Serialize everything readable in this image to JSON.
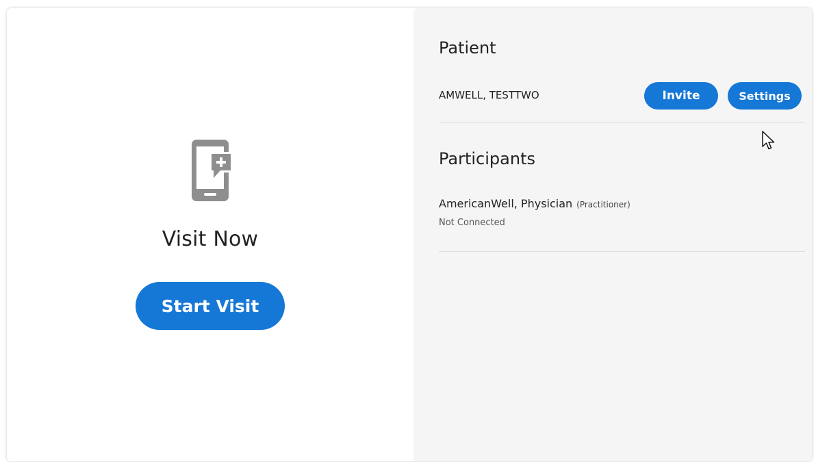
{
  "visit": {
    "title": "Visit Now",
    "start_label": "Start Visit",
    "icon": "mobile-chat-add-icon"
  },
  "patient": {
    "section_title": "Patient",
    "name": "AMWELL, TESTTWO",
    "invite_label": "Invite",
    "settings_label": "Settings"
  },
  "participants": {
    "section_title": "Participants",
    "items": [
      {
        "name": "AmericanWell, Physician",
        "role": "(Practitioner)",
        "status": "Not Connected"
      }
    ]
  },
  "colors": {
    "accent": "#1577d6",
    "panel_bg": "#f5f5f5",
    "icon_gray": "#8e8e8e"
  }
}
